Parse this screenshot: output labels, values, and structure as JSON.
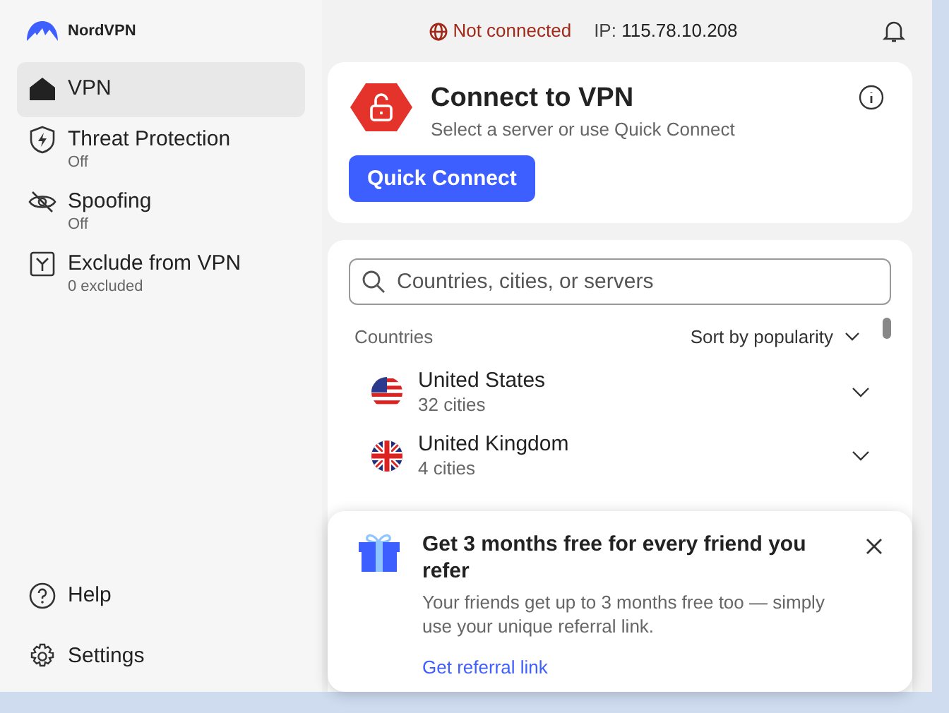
{
  "app": {
    "name": "NordVPN"
  },
  "status": {
    "connection": "Not connected",
    "connected": false,
    "ip_label": "IP:",
    "ip": "115.78.10.208"
  },
  "sidebar": {
    "items": [
      {
        "kind": "vpn",
        "label": "VPN",
        "selected": true
      },
      {
        "kind": "shield",
        "label": "Threat Protection",
        "sub": "Off",
        "selected": false
      },
      {
        "kind": "eye",
        "label": "Spoofing",
        "sub": "Off",
        "selected": false
      },
      {
        "kind": "split",
        "label": "Exclude from VPN",
        "sub": "0 excluded",
        "selected": false
      }
    ],
    "footer": [
      {
        "kind": "help",
        "label": "Help"
      },
      {
        "kind": "gear",
        "label": "Settings"
      }
    ]
  },
  "connect_card": {
    "title": "Connect to VPN",
    "subtitle": "Select a server or use Quick Connect",
    "button": "Quick Connect"
  },
  "search": {
    "placeholder": "Countries, cities, or servers"
  },
  "list": {
    "heading": "Countries",
    "sort": "Sort by popularity",
    "countries": [
      {
        "kind": "us",
        "name": "United States",
        "cities": "32 cities"
      },
      {
        "kind": "uk",
        "name": "United Kingdom",
        "cities": "4 cities"
      }
    ]
  },
  "popup": {
    "title": "Get 3 months free for every friend you refer",
    "body": "Your friends get up to 3 months free too — simply use your unique referral link.",
    "link": "Get referral link"
  }
}
